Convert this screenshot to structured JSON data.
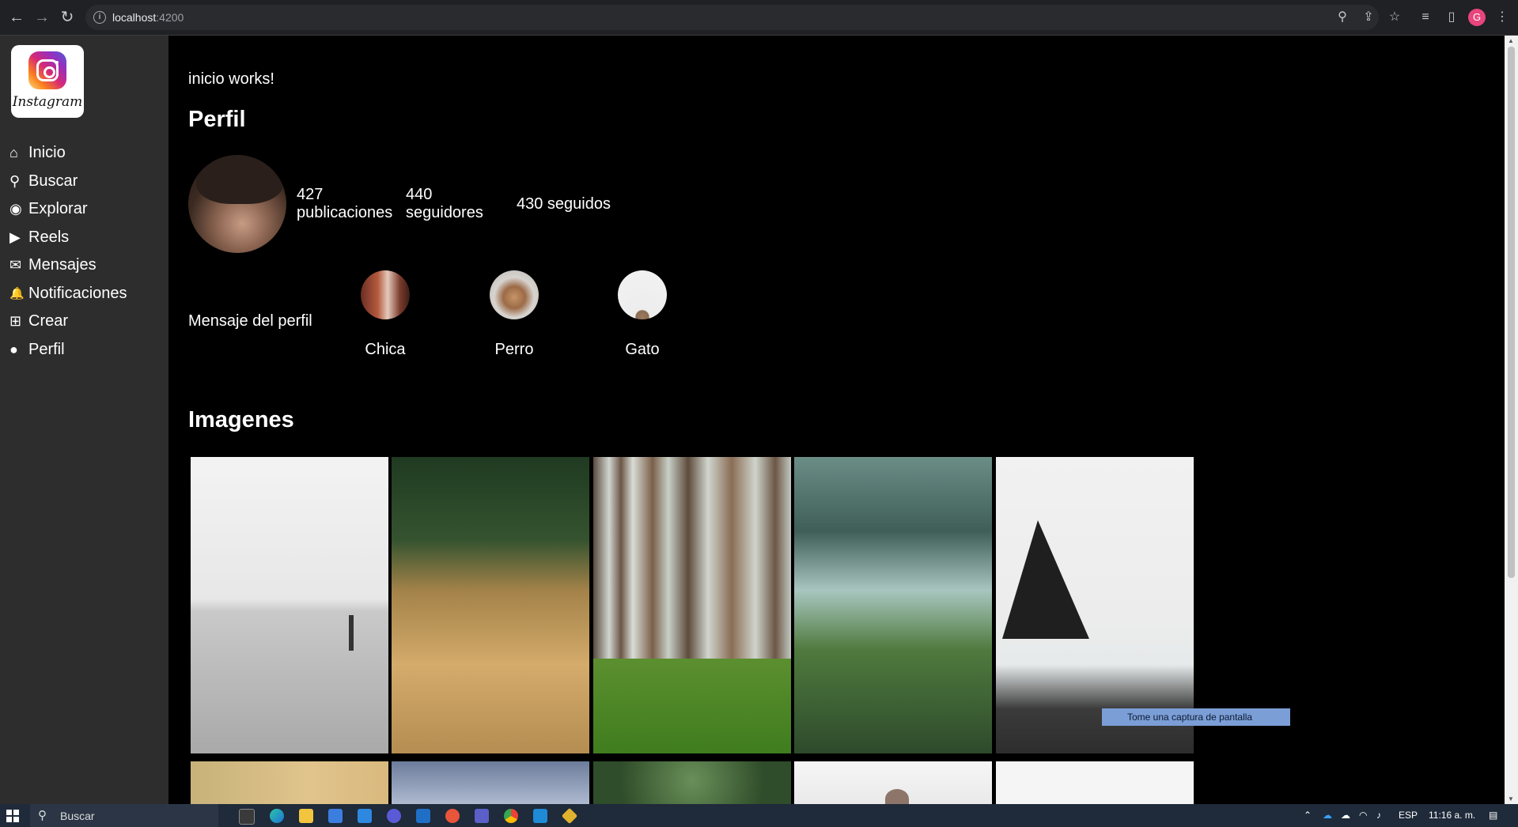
{
  "browser": {
    "url_host": "localhost",
    "url_port": ":4200",
    "profile_initial": "G"
  },
  "sidebar": {
    "logo_text": "Instagram",
    "items": [
      {
        "icon": "home-icon",
        "glyph": "⌂",
        "label": "Inicio"
      },
      {
        "icon": "search-icon",
        "glyph": "⚲",
        "label": "Buscar"
      },
      {
        "icon": "compass-icon",
        "glyph": "◉",
        "label": "Explorar"
      },
      {
        "icon": "video-icon",
        "glyph": "▶",
        "label": "Reels"
      },
      {
        "icon": "envelope-icon",
        "glyph": "✉",
        "label": "Mensajes"
      },
      {
        "icon": "bell-icon",
        "glyph": "🔔",
        "label": "Notificaciones"
      },
      {
        "icon": "plus-square-icon",
        "glyph": "⊞",
        "label": "Crear"
      },
      {
        "icon": "user-icon",
        "glyph": "●",
        "label": "Perfil"
      }
    ]
  },
  "main": {
    "works_text": "inicio works!",
    "perfil_title": "Perfil",
    "stats": {
      "posts_count": "427",
      "posts_label": "publicaciones",
      "followers_count": "440",
      "followers_label": "seguidores",
      "following": "430 seguidos"
    },
    "profile_message": "Mensaje del perfil",
    "stories": [
      {
        "label": "Chica"
      },
      {
        "label": "Perro"
      },
      {
        "label": "Gato"
      }
    ],
    "imagenes_title": "Imagenes",
    "images": [
      {
        "name": "sea-pole-image"
      },
      {
        "name": "wheat-image"
      },
      {
        "name": "pine-forest-image"
      },
      {
        "name": "misty-green-image"
      },
      {
        "name": "rock-beach-image"
      }
    ]
  },
  "tooltip": "Tome una captura de pantalla",
  "taskbar": {
    "search_text": "Buscar",
    "language": "ESP",
    "time": "11:16 a. m."
  },
  "colors": {
    "sidebar_bg": "#2d2d2d",
    "main_bg": "#000000",
    "chrome_bg": "#202124",
    "taskbar_bg": "#1f2a3a"
  }
}
